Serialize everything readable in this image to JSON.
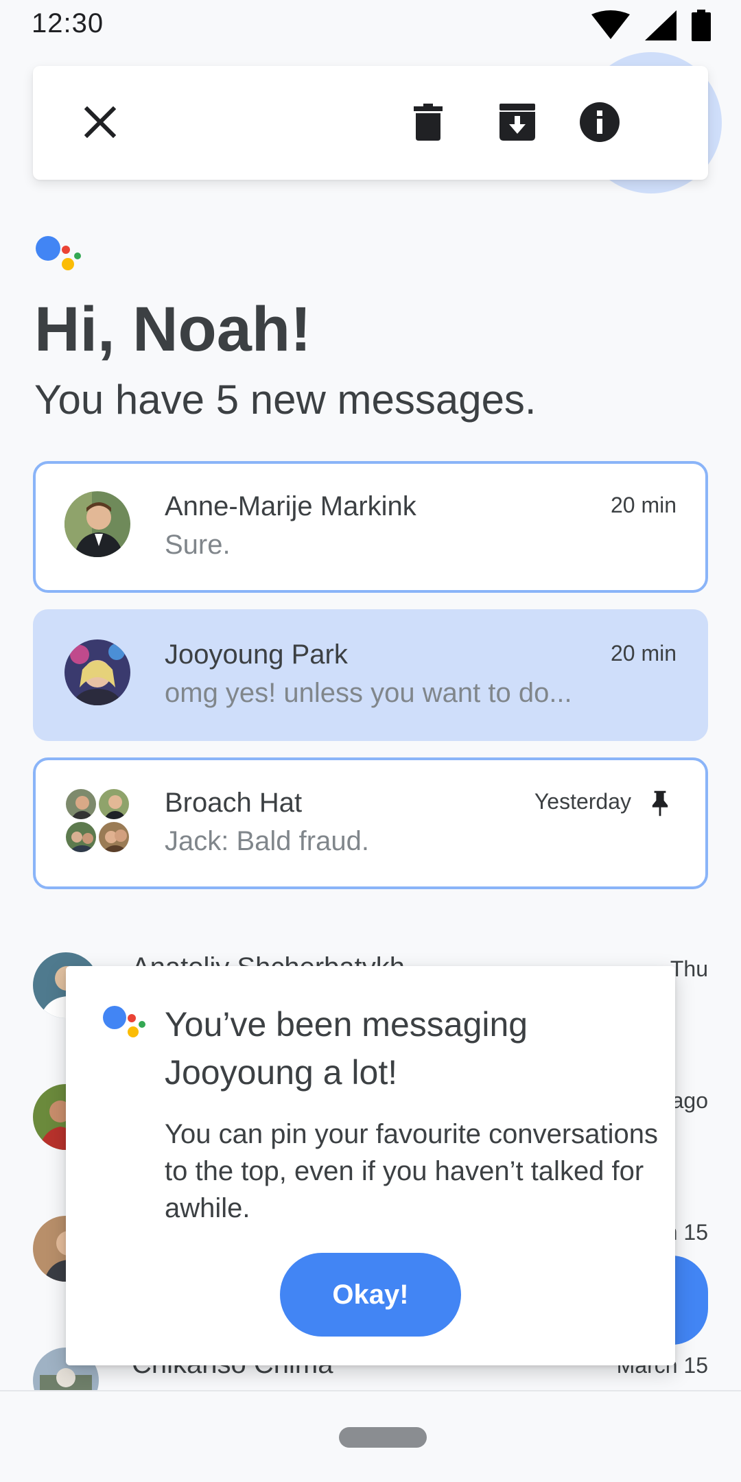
{
  "status_bar": {
    "time": "12:30"
  },
  "action_bar": {
    "close_icon": "close-icon",
    "delete_icon": "delete-icon",
    "archive_icon": "archive-icon",
    "info_icon": "info-icon",
    "pin_icon": "pin-icon"
  },
  "greeting": {
    "title": "Hi, Noah!",
    "subtitle": "You have 5 new messages."
  },
  "conversations": [
    {
      "name": "Anne-Marije Markink",
      "snippet": "Sure.",
      "time": "20 min",
      "pinned": false
    },
    {
      "name": "Jooyoung Park",
      "snippet": "omg yes! unless you want to do...",
      "time": "20 min",
      "pinned": false
    },
    {
      "name": "Broach Hat",
      "snippet": "Jack: Bald fraud.",
      "time": "Yesterday",
      "pinned": true
    }
  ],
  "background_list": [
    {
      "name": "Anatoliy Shcherbatykh",
      "time": "Thu"
    },
    {
      "name": "",
      "time": "ago"
    },
    {
      "name": "",
      "time": "n 15"
    },
    {
      "name": "Chikanso Chima",
      "time": "March 15"
    }
  ],
  "dialog": {
    "title": "You’ve been messaging Jooyoung a lot!",
    "body": "You can pin your favourite conversations to the top, even if you haven’t talked for awhile.",
    "button": "Okay!"
  },
  "colors": {
    "accent": "#4285f4",
    "selected_bg": "#cfdefa",
    "outline": "#8ab4f8",
    "assistant_blue": "#4285f4",
    "assistant_red": "#ea4335",
    "assistant_yellow": "#fbbc05",
    "assistant_green": "#34a853"
  }
}
